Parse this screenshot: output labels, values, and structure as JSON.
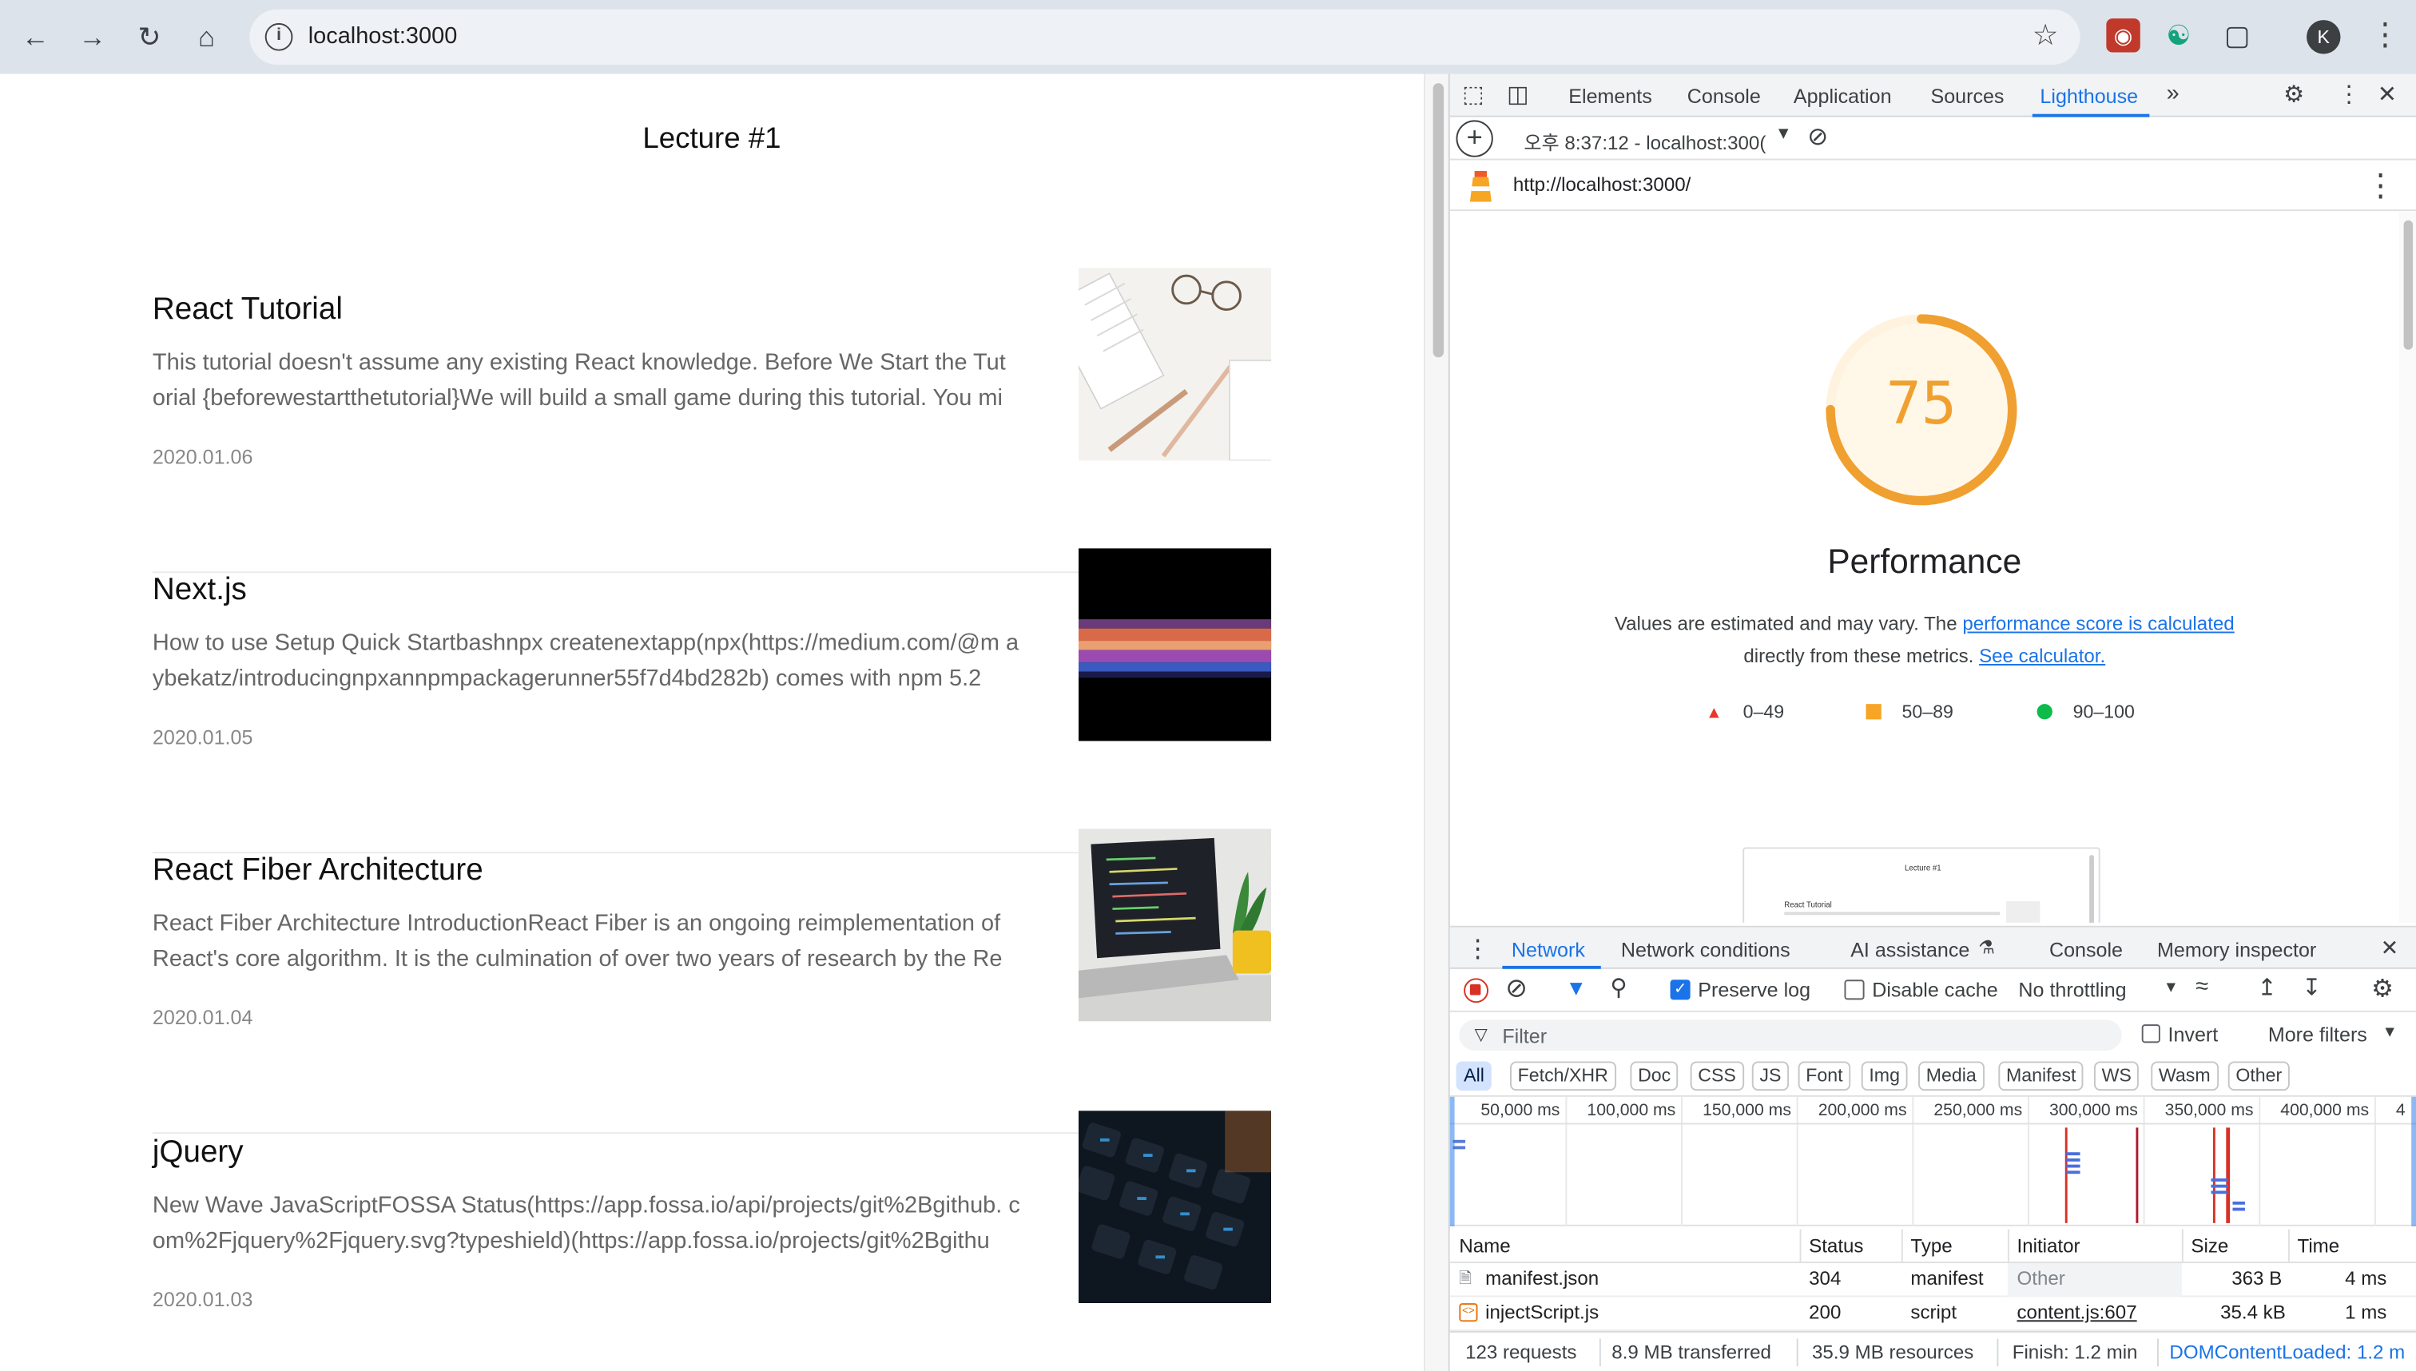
{
  "browser": {
    "url": "localhost:3000",
    "avatar_initial": "K"
  },
  "page": {
    "title": "Lecture #1",
    "posts": [
      {
        "title": "React Tutorial",
        "desc": "This tutorial doesn't assume any existing React knowledge. Before We Start the Tut orial {beforewestartthetutorial}We will build a small game during this tutorial. You mi",
        "date": "2020.01.06"
      },
      {
        "title": "Next.js",
        "desc": "How to use Setup Quick Startbashnpx createnextapp(npx(https://medium.com/@m aybekatz/introducingnpxannpmpackagerunner55f7d4bd282b) comes with npm 5.2",
        "date": "2020.01.05"
      },
      {
        "title": "React Fiber Architecture",
        "desc": "React Fiber Architecture IntroductionReact Fiber is an ongoing reimplementation of React's core algorithm. It is the culmination of over two years of research by the Re",
        "date": "2020.01.04"
      },
      {
        "title": "jQuery",
        "desc": "New Wave JavaScriptFOSSA Status(https://app.fossa.io/api/projects/git%2Bgithub. com%2Fjquery%2Fjquery.svg?typeshield)(https://app.fossa.io/projects/git%2Bgithu",
        "date": "2020.01.03"
      }
    ]
  },
  "devtools": {
    "tabs": [
      "Elements",
      "Console",
      "Application",
      "Sources",
      "Lighthouse"
    ],
    "active_tab": "Lighthouse",
    "report_selector": "오후 8:37:12 - localhost:300(",
    "report_url": "http://localhost:3000/",
    "score": "75",
    "score_value": 75,
    "score_color": "#f0a030",
    "category": "Performance",
    "note_prefix": "Values are estimated and may vary. The",
    "note_link1": "performance score is calculated",
    "note_mid": "directly from these metrics.",
    "note_link2": "See calculator.",
    "legend": [
      {
        "label": "0–49",
        "color": "#e8382d"
      },
      {
        "label": "50–89",
        "color": "#f7a527"
      },
      {
        "label": "90–100",
        "color": "#0cbb49"
      }
    ],
    "preview_title": "Lecture #1",
    "preview_post": "React Tutorial"
  },
  "drawer": {
    "tabs": [
      "Network",
      "Network conditions",
      "AI assistance",
      "Console",
      "Memory inspector"
    ],
    "active_tab": "Network",
    "preserve_log": "Preserve log",
    "preserve_log_checked": true,
    "disable_cache": "Disable cache",
    "disable_cache_checked": false,
    "throttling": "No throttling",
    "filter_placeholder": "Filter",
    "invert": "Invert",
    "more_filters": "More filters",
    "types": [
      "All",
      "Fetch/XHR",
      "Doc",
      "CSS",
      "JS",
      "Font",
      "Img",
      "Media",
      "Manifest",
      "WS",
      "Wasm",
      "Other"
    ],
    "active_type": "All",
    "timeline_labels": [
      "50,000 ms",
      "100,000 ms",
      "150,000 ms",
      "200,000 ms",
      "250,000 ms",
      "300,000 ms",
      "350,000 ms",
      "400,000 ms",
      "4"
    ],
    "columns": [
      "Name",
      "Status",
      "Type",
      "Initiator",
      "Size",
      "Time"
    ],
    "rows": [
      {
        "name": "manifest.json",
        "status": "304",
        "type": "manifest",
        "initiator": "Other",
        "size": "363 B",
        "time": "4 ms"
      },
      {
        "name": "injectScript.js",
        "status": "200",
        "type": "script",
        "initiator": "content.js:607",
        "size": "35.4 kB",
        "time": "1 ms"
      }
    ],
    "summary": {
      "requests": "123 requests",
      "transferred": "8.9 MB transferred",
      "resources": "35.9 MB resources",
      "finish": "Finish: 1.2 min",
      "dcl": "DOMContentLoaded: 1.2 m"
    }
  }
}
